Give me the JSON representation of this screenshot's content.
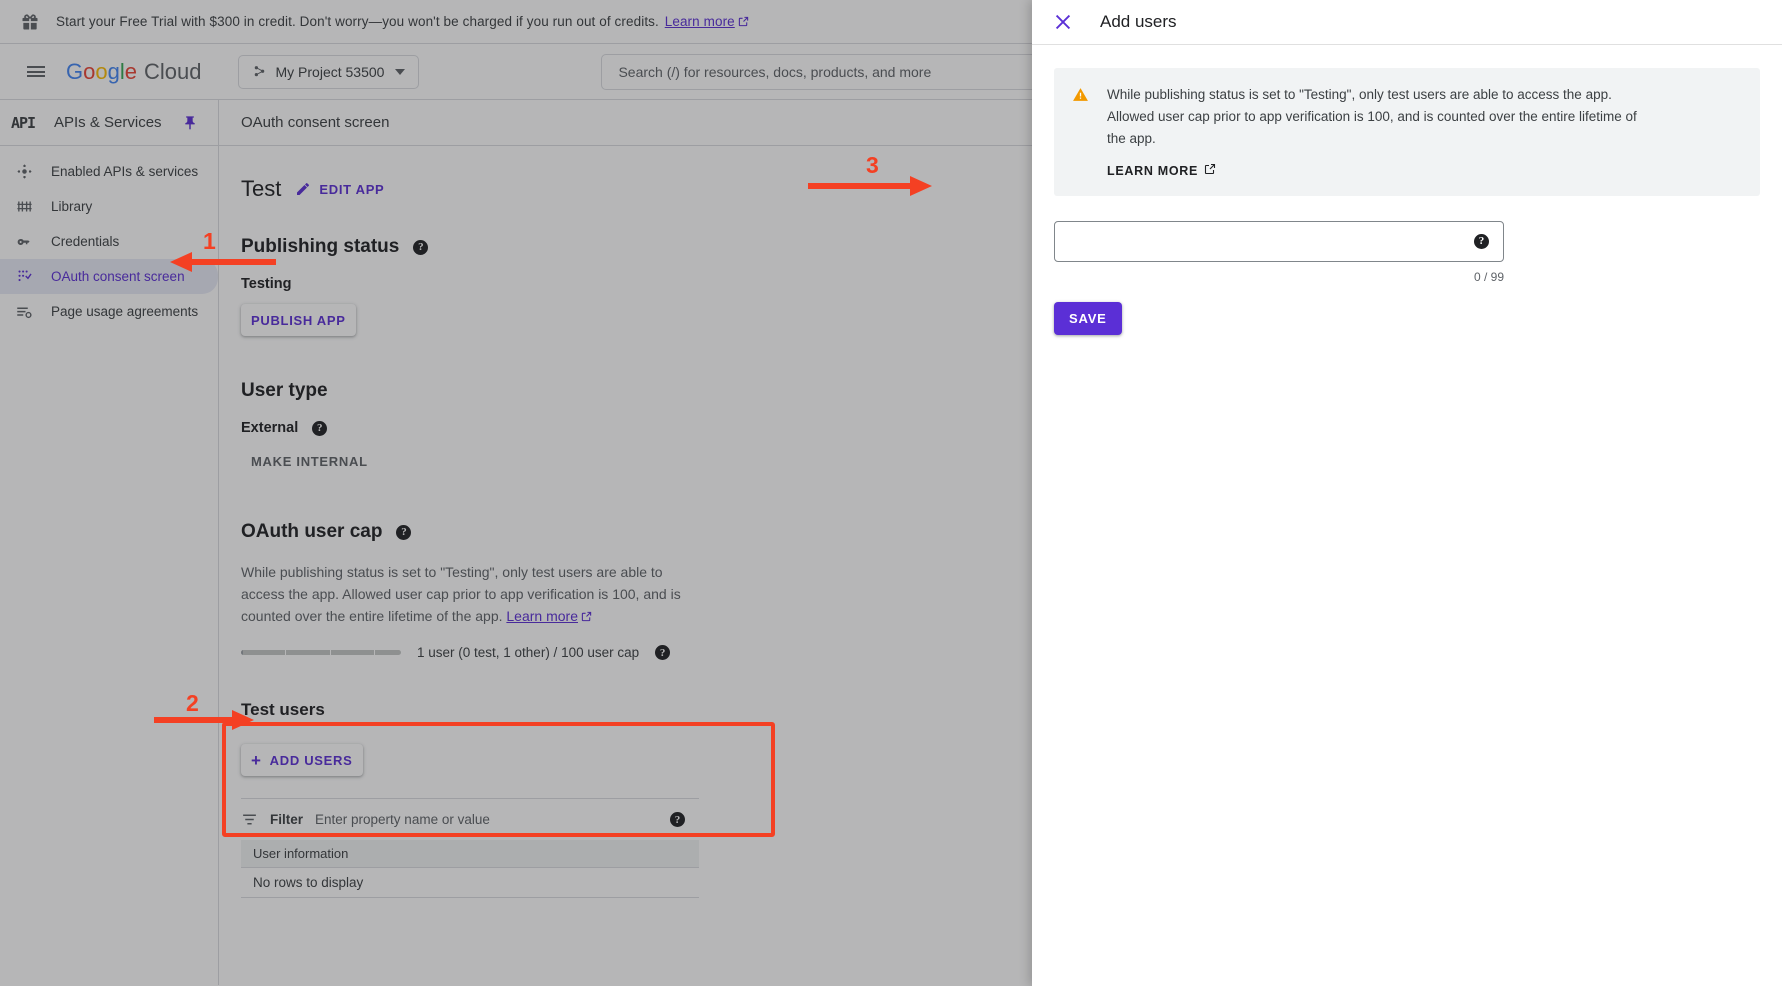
{
  "promo": {
    "text": "Start your Free Trial with $300 in credit. Don't worry—you won't be charged if you run out of credits.",
    "link_label": "Learn more",
    "icon": "gift-icon"
  },
  "appbar": {
    "menu_icon": "hamburger-icon",
    "brand": {
      "g1": "G",
      "g2": "o",
      "g3": "o",
      "g4": "g",
      "g5": "l",
      "g6": "e",
      "cloud": "Cloud"
    },
    "project_name": "My Project 53500",
    "project_icon": "project-nodes-icon",
    "search_placeholder": "Search (/) for resources, docs, products, and more",
    "search_value": ""
  },
  "sidebar": {
    "logo_text": "API",
    "title": "APIs & Services",
    "pin_icon": "pin-icon",
    "items": [
      {
        "label": "Enabled APIs & services",
        "icon": "enabled-apis-icon",
        "active": false
      },
      {
        "label": "Library",
        "icon": "library-icon",
        "active": false
      },
      {
        "label": "Credentials",
        "icon": "key-icon",
        "active": false
      },
      {
        "label": "OAuth consent screen",
        "icon": "consent-screen-icon",
        "active": true
      },
      {
        "label": "Page usage agreements",
        "icon": "agreements-icon",
        "active": false
      }
    ]
  },
  "main": {
    "breadcrumb": "OAuth consent screen",
    "app_name": "Test",
    "edit_app_label": "EDIT APP",
    "publishing": {
      "heading": "Publishing status",
      "status": "Testing",
      "publish_button": "PUBLISH APP"
    },
    "user_type": {
      "heading": "User type",
      "value": "External",
      "make_internal_label": "MAKE INTERNAL"
    },
    "user_cap": {
      "heading": "OAuth user cap",
      "body": "While publishing status is set to \"Testing\", only test users are able to access the app. Allowed user cap prior to app verification is 100, and is counted over the entire lifetime of the app.",
      "body_link": "Learn more",
      "counter_text": "1 user (0 test, 1 other) / 100 user cap"
    },
    "test_users": {
      "heading": "Test users",
      "add_users_label": "ADD USERS"
    },
    "filter": {
      "label": "Filter",
      "placeholder": "Enter property name or value",
      "value": ""
    },
    "table": {
      "columns": [
        "User information"
      ],
      "empty_message": "No rows to display"
    }
  },
  "panel": {
    "title": "Add users",
    "close_icon": "close-icon",
    "alert": {
      "icon": "warning-icon",
      "text": "While publishing status is set to \"Testing\", only test users are able to access the app. Allowed user cap prior to app verification is 100, and is counted over the entire lifetime of the app.",
      "learn_more_label": "LEARN MORE"
    },
    "input": {
      "value": "",
      "placeholder": "",
      "counter": "0 / 99"
    },
    "save_label": "SAVE"
  },
  "annotations": {
    "accent_color": "#f44023",
    "markers": [
      {
        "number": "1",
        "target": "sidebar-item-oauth-consent-screen"
      },
      {
        "number": "2",
        "target": "add-users-button"
      },
      {
        "number": "3",
        "target": "add-users-input"
      }
    ]
  },
  "colors": {
    "brand_purple": "#5b2fd6",
    "scrim": "rgba(32,33,36,.33)",
    "annotation_red": "#f44023"
  }
}
